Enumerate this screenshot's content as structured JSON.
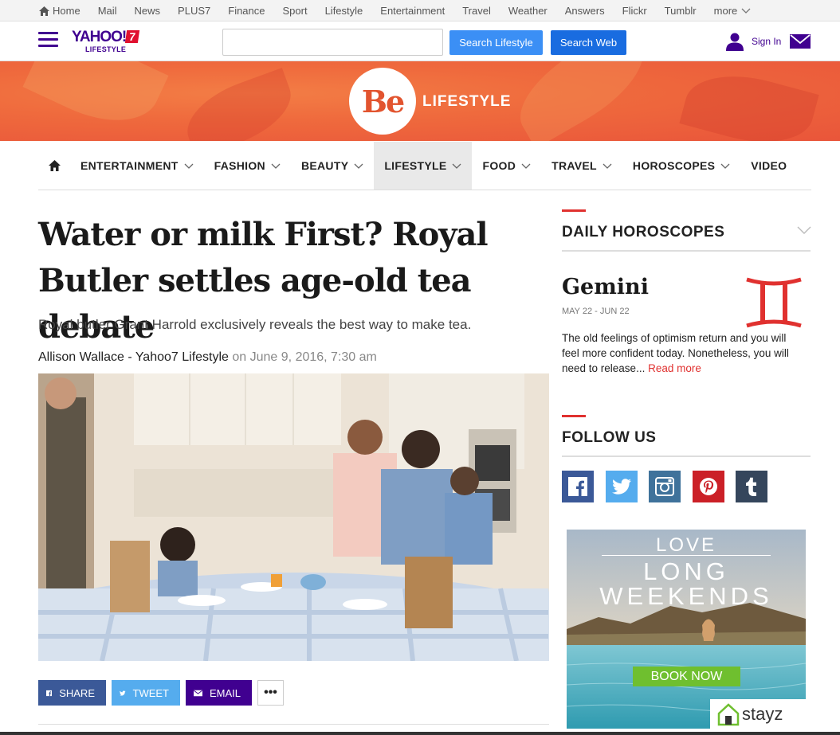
{
  "topnav": {
    "items": [
      "Home",
      "Mail",
      "News",
      "PLUS7",
      "Finance",
      "Sport",
      "Lifestyle",
      "Entertainment",
      "Travel",
      "Weather",
      "Answers",
      "Flickr",
      "Tumblr",
      "more"
    ]
  },
  "header": {
    "logo_text": "YAHOO!",
    "logo_sub": "LIFESTYLE",
    "logo_number": "7",
    "search_placeholder": "",
    "search_lifestyle_label": "Search Lifestyle",
    "search_web_label": "Search Web",
    "signin_label": "Sign In"
  },
  "banner": {
    "logo_text": "Be",
    "section_text": "LIFESTYLE"
  },
  "nav": {
    "items": [
      {
        "label": "ENTERTAINMENT",
        "has_dropdown": true
      },
      {
        "label": "FASHION",
        "has_dropdown": true
      },
      {
        "label": "BEAUTY",
        "has_dropdown": true
      },
      {
        "label": "LIFESTYLE",
        "has_dropdown": true,
        "active": true
      },
      {
        "label": "FOOD",
        "has_dropdown": true
      },
      {
        "label": "TRAVEL",
        "has_dropdown": true
      },
      {
        "label": "HOROSCOPES",
        "has_dropdown": true
      },
      {
        "label": "VIDEO",
        "has_dropdown": false
      }
    ]
  },
  "article": {
    "headline": "Water or milk First? Royal Butler settles age-old tea debate",
    "summary": "Royal butler Grant Harrold exclusively reveals the best way to make tea.",
    "author": "Allison Wallace - Yahoo7 Lifestyle",
    "date": "on June 9, 2016, 7:30 am",
    "share": {
      "facebook": "SHARE",
      "twitter": "TWEET",
      "email": "EMAIL",
      "more": "•••"
    }
  },
  "sidebar": {
    "horoscope_title": "DAILY HOROSCOPES",
    "sign_name": "Gemini",
    "sign_dates": "MAY 22 - JUN 22",
    "sign_glyph": "♊",
    "sign_text": "The old feelings of optimism return and you will feel more confident today. Nonetheless, you will need to release...",
    "read_more": "Read more",
    "follow_title": "FOLLOW US",
    "socials": [
      "facebook-icon",
      "twitter-icon",
      "instagram-icon",
      "pinterest-icon",
      "tumblr-icon"
    ]
  },
  "ad": {
    "line1": "LOVE",
    "line2": "LONG",
    "line3": "WEEKENDS",
    "button": "BOOK NOW",
    "brand": "stayz"
  },
  "colors": {
    "yahoo_purple": "#400090",
    "accent_red": "#e0312f",
    "facebook": "#3b5998",
    "twitter": "#55acee",
    "pinterest": "#cb2027",
    "tumblr": "#35465c",
    "instagram": "#3f729b"
  }
}
